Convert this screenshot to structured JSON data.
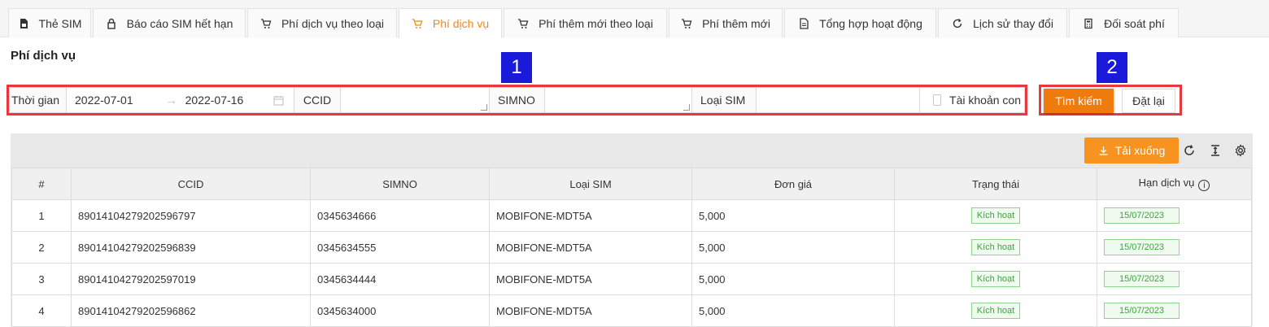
{
  "tabs": [
    {
      "label": "Thẻ SIM",
      "icon": "sim-card-icon"
    },
    {
      "label": "Báo cáo SIM hết hạn",
      "icon": "lock-icon"
    },
    {
      "label": "Phí dịch vụ theo loại",
      "icon": "cart-icon"
    },
    {
      "label": "Phí dịch vụ",
      "icon": "cart-icon"
    },
    {
      "label": "Phí thêm mới theo loại",
      "icon": "cart-icon"
    },
    {
      "label": "Phí thêm mới",
      "icon": "cart-icon"
    },
    {
      "label": "Tổng hợp hoạt động",
      "icon": "document-icon"
    },
    {
      "label": "Lịch sử thay đổi",
      "icon": "refresh-icon"
    },
    {
      "label": "Đối soát phí",
      "icon": "calculator-icon"
    }
  ],
  "active_tab": "Phí dịch vụ",
  "page_title": "Phí dịch vụ",
  "filter": {
    "time_label": "Thời gian",
    "date_from": "2022-07-01",
    "date_to": "2022-07-16",
    "ccid_label": "CCID",
    "ccid_value": "",
    "simno_label": "SIMNO",
    "simno_value": "",
    "sim_type_label": "Loại SIM",
    "sim_type_value": "",
    "sub_account_label": "Tài khoản con",
    "sub_account_checked": false
  },
  "buttons": {
    "search": "Tìm kiếm",
    "reset": "Đặt lại",
    "download": "Tải xuống"
  },
  "annotations": {
    "one": "1",
    "two": "2"
  },
  "table": {
    "headers": [
      "#",
      "CCID",
      "SIMNO",
      "Loại SIM",
      "Đơn giá",
      "Trạng thái",
      "Hạn dịch vụ"
    ],
    "rows": [
      {
        "no": "1",
        "ccid": "89014104279202596797",
        "simno": "0345634666",
        "sim_type": "MOBIFONE-MDT5A",
        "price": "5,000",
        "status": "Kích hoạt",
        "expiry": "15/07/2023"
      },
      {
        "no": "2",
        "ccid": "89014104279202596839",
        "simno": "0345634555",
        "sim_type": "MOBIFONE-MDT5A",
        "price": "5,000",
        "status": "Kích hoạt",
        "expiry": "15/07/2023"
      },
      {
        "no": "3",
        "ccid": "89014104279202597019",
        "simno": "0345634444",
        "sim_type": "MOBIFONE-MDT5A",
        "price": "5,000",
        "status": "Kích hoạt",
        "expiry": "15/07/2023"
      },
      {
        "no": "4",
        "ccid": "89014104279202596862",
        "simno": "0345634000",
        "sim_type": "MOBIFONE-MDT5A",
        "price": "5,000",
        "status": "Kích hoạt",
        "expiry": "15/07/2023"
      }
    ]
  },
  "colors": {
    "accent": "#f0891a",
    "search_button": "#ee7b0b",
    "download_button": "#f7931e",
    "annotation_box": "#e8383e",
    "annotation_number": "#1a1adb",
    "status_green": "#3ba53b"
  }
}
